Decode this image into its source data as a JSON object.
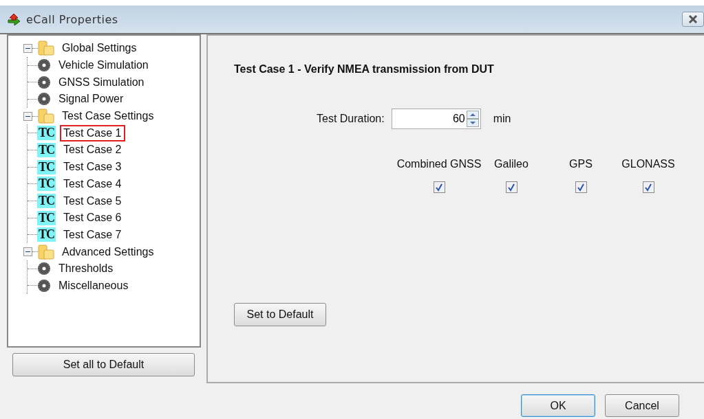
{
  "window": {
    "title": "eCall  Properties"
  },
  "tree": [
    {
      "kind": "folder",
      "label": "Global Settings",
      "expanded": true,
      "selected": false,
      "children": [
        {
          "kind": "gear",
          "label": "Vehicle Simulation",
          "selected": false
        },
        {
          "kind": "gear",
          "label": "GNSS Simulation",
          "selected": false
        },
        {
          "kind": "gear",
          "label": "Signal Power",
          "selected": false
        }
      ]
    },
    {
      "kind": "folder",
      "label": "Test Case Settings",
      "expanded": true,
      "selected": false,
      "children": [
        {
          "kind": "tc",
          "badge": "TC",
          "label": "Test Case 1",
          "selected": true
        },
        {
          "kind": "tc",
          "badge": "TC",
          "label": "Test Case 2",
          "selected": false
        },
        {
          "kind": "tc",
          "badge": "TC",
          "label": "Test Case 3",
          "selected": false
        },
        {
          "kind": "tc",
          "badge": "TC",
          "label": "Test Case 4",
          "selected": false
        },
        {
          "kind": "tc",
          "badge": "TC",
          "label": "Test Case 5",
          "selected": false
        },
        {
          "kind": "tc",
          "badge": "TC",
          "label": "Test Case 6",
          "selected": false
        },
        {
          "kind": "tc",
          "badge": "TC",
          "label": "Test Case 7",
          "selected": false
        }
      ]
    },
    {
      "kind": "folder",
      "label": "Advanced Settings",
      "expanded": true,
      "selected": false,
      "children": [
        {
          "kind": "gear",
          "label": "Thresholds",
          "selected": false
        },
        {
          "kind": "gear",
          "label": "Miscellaneous",
          "selected": false
        }
      ]
    }
  ],
  "left_button": "Set all to Default",
  "panel": {
    "heading": "Test Case 1 - Verify NMEA transmission from DUT",
    "duration": {
      "label": "Test Duration:",
      "value": "60",
      "unit": "min"
    },
    "systems": [
      {
        "label": "Combined GNSS",
        "checked": true
      },
      {
        "label": "Galileo",
        "checked": true
      },
      {
        "label": "GPS",
        "checked": true
      },
      {
        "label": "GLONASS",
        "checked": true
      }
    ],
    "default_button": "Set to Default"
  },
  "buttons": [
    "OK",
    "Cancel"
  ]
}
